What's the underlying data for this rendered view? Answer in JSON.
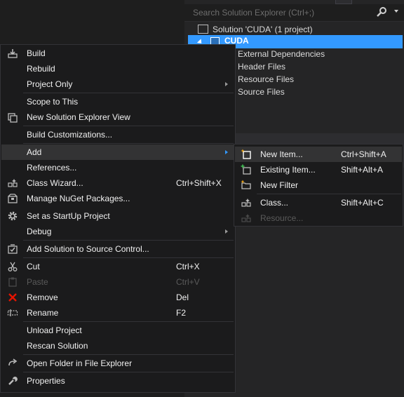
{
  "solution_explorer": {
    "search_placeholder": "Search Solution Explorer (Ctrl+;)",
    "solution_label": "Solution 'CUDA' (1 project)",
    "project_label": "CUDA",
    "children": [
      "External Dependencies",
      "Header Files",
      "Resource Files",
      "Source Files"
    ]
  },
  "context_menu": {
    "items": [
      {
        "label": "Build",
        "icon": "build-icon"
      },
      {
        "label": "Rebuild"
      },
      {
        "label": "Project Only",
        "submenu": true
      },
      {
        "label": "Scope to This"
      },
      {
        "label": "New Solution Explorer View",
        "icon": "new-view-icon"
      },
      {
        "label": "Build Customizations..."
      },
      {
        "label": "Add",
        "submenu": true,
        "highlighted": true
      },
      {
        "label": "References..."
      },
      {
        "label": "Class Wizard...",
        "shortcut": "Ctrl+Shift+X",
        "icon": "class-wizard-icon"
      },
      {
        "label": "Manage NuGet Packages...",
        "icon": "nuget-icon"
      },
      {
        "label": "Set as StartUp Project",
        "icon": "gear-icon"
      },
      {
        "label": "Debug",
        "submenu": true
      },
      {
        "label": "Add Solution to Source Control...",
        "icon": "source-control-icon"
      },
      {
        "label": "Cut",
        "shortcut": "Ctrl+X",
        "icon": "scissors-icon"
      },
      {
        "label": "Paste",
        "shortcut": "Ctrl+V",
        "icon": "paste-icon",
        "disabled": true
      },
      {
        "label": "Remove",
        "shortcut": "Del",
        "icon": "remove-icon"
      },
      {
        "label": "Rename",
        "shortcut": "F2",
        "icon": "rename-icon"
      },
      {
        "label": "Unload Project"
      },
      {
        "label": "Rescan Solution"
      },
      {
        "label": "Open Folder in File Explorer",
        "icon": "open-folder-icon"
      },
      {
        "label": "Properties",
        "icon": "wrench-icon"
      }
    ]
  },
  "add_submenu": {
    "items": [
      {
        "label": "New Item...",
        "shortcut": "Ctrl+Shift+A",
        "icon": "new-item-icon",
        "highlighted": true
      },
      {
        "label": "Existing Item...",
        "shortcut": "Shift+Alt+A",
        "icon": "existing-item-icon"
      },
      {
        "label": "New Filter",
        "icon": "new-filter-icon"
      },
      {
        "label": "Class...",
        "shortcut": "Shift+Alt+C",
        "icon": "class-icon"
      },
      {
        "label": "Resource...",
        "icon": "resource-icon",
        "disabled": true
      }
    ]
  },
  "colors": {
    "selection": "#3399ff",
    "menu_bg": "#1b1b1c",
    "highlight": "#333334",
    "remove_red": "#e51400"
  }
}
